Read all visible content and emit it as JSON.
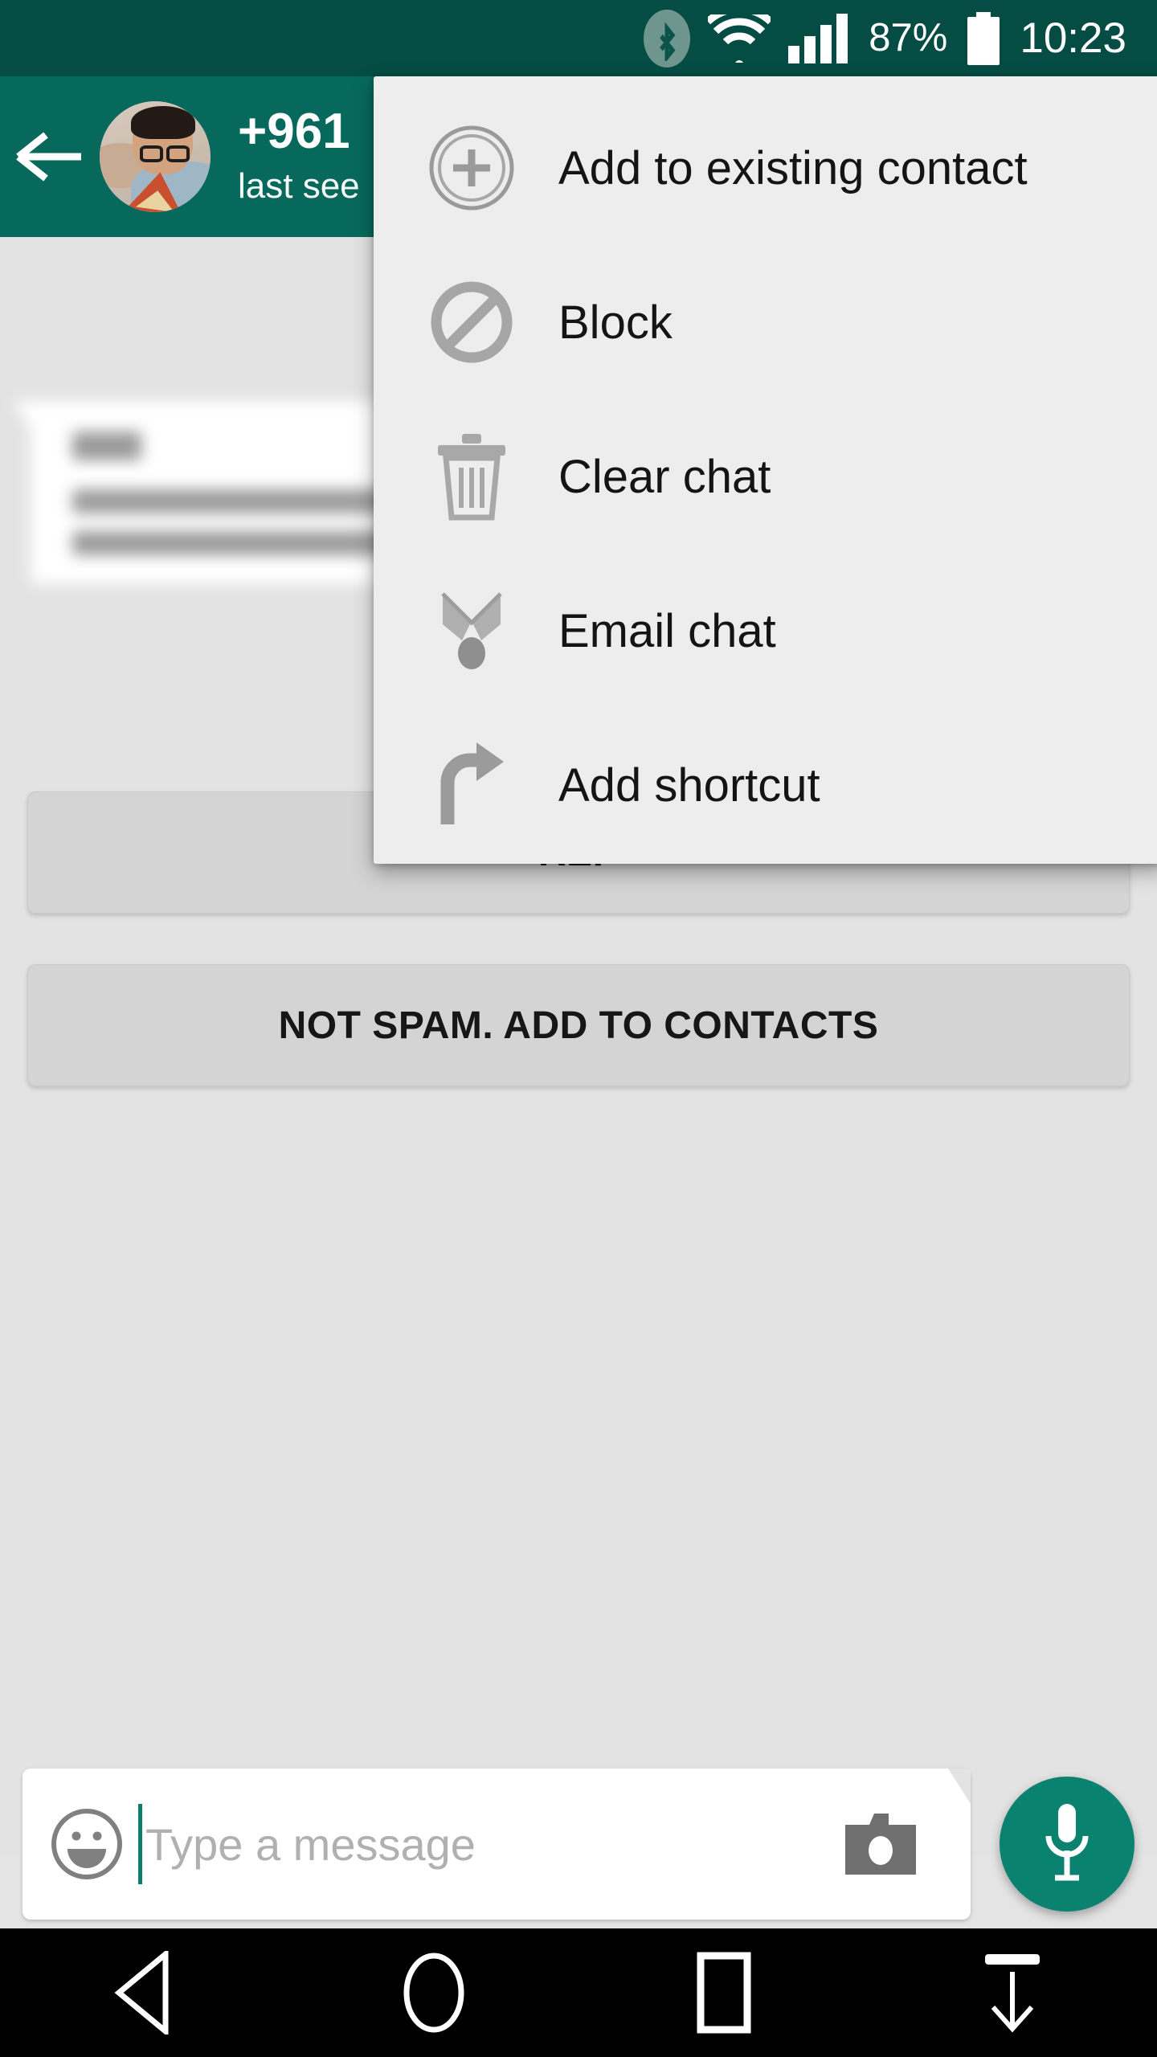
{
  "status_bar": {
    "bluetooth_icon": "bluetooth-icon",
    "wifi_icon": "wifi-icon",
    "signal_icon": "cellular-signal-icon",
    "battery_percent": "87%",
    "battery_icon": "battery-icon",
    "clock": "10:23"
  },
  "toolbar": {
    "back_icon": "back-arrow-icon",
    "avatar_icon": "contact-avatar",
    "contact_name": "+961",
    "contact_status": "last see"
  },
  "chat": {
    "message_bubble_redacted": "",
    "spam_notice": "The sen",
    "report_button": "REP",
    "not_spam_button": "NOT SPAM. ADD TO CONTACTS"
  },
  "overflow_menu": {
    "items": [
      {
        "label": "Add to existing contact",
        "icon": "add-circle-icon"
      },
      {
        "label": "Block",
        "icon": "block-icon"
      },
      {
        "label": "Clear chat",
        "icon": "trash-icon"
      },
      {
        "label": "Email chat",
        "icon": "email-chat-icon"
      },
      {
        "label": "Add shortcut",
        "icon": "shortcut-arrow-icon"
      }
    ]
  },
  "input_bar": {
    "emoji_icon": "emoji-smiley-icon",
    "placeholder": "Type a message",
    "value": "",
    "camera_icon": "camera-icon",
    "mic_icon": "microphone-icon"
  },
  "nav_bar": {
    "back": "nav-back-icon",
    "home": "nav-home-icon",
    "recents": "nav-recents-icon",
    "hide": "nav-hide-icon"
  },
  "colors": {
    "status_bar": "#054d44",
    "toolbar": "#07695c",
    "accent": "#09836f",
    "chat_background": "#e3e3e3",
    "menu_background": "#ededed",
    "button_background": "#d4d4d4"
  }
}
